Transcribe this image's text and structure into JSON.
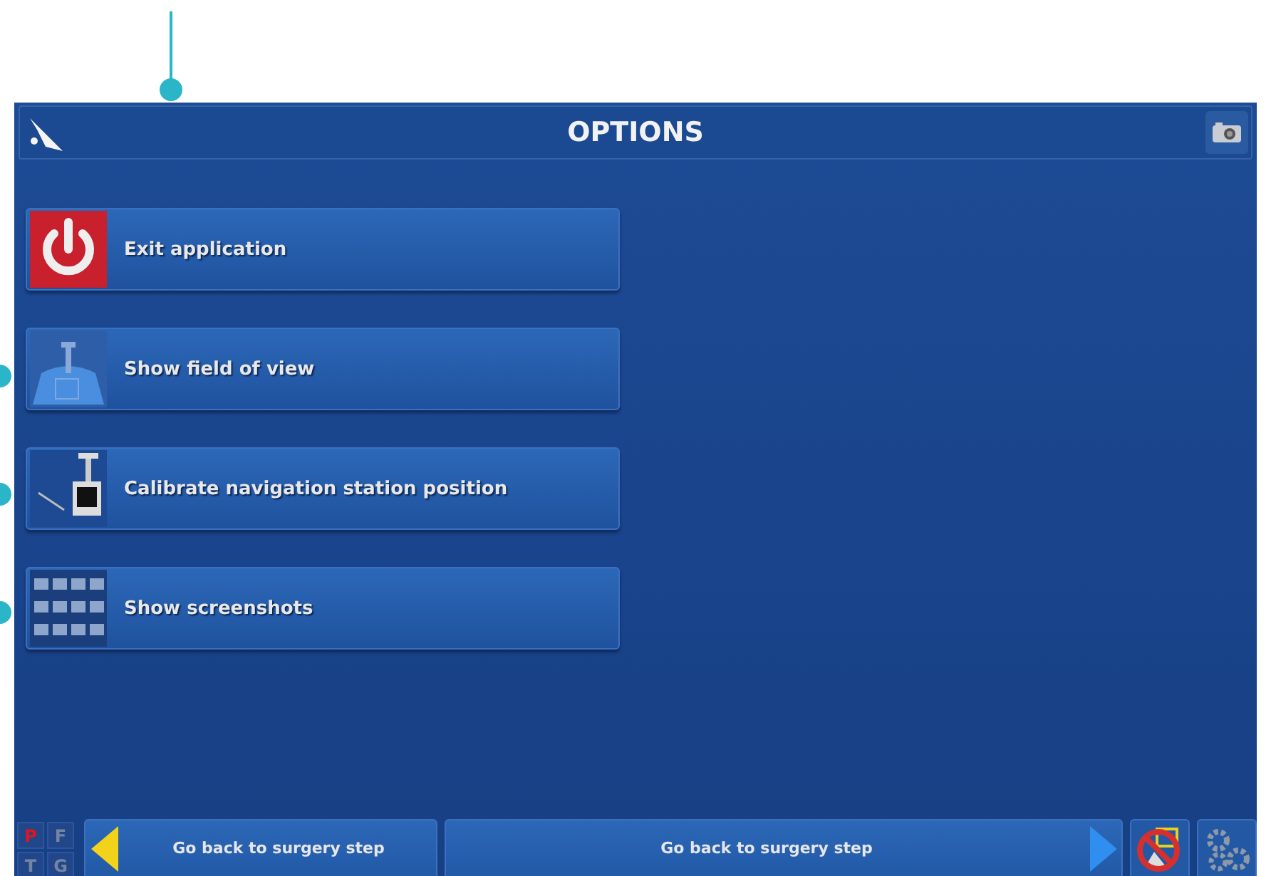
{
  "header": {
    "title": "OPTIONS"
  },
  "menu_items": [
    {
      "kind": "power",
      "label": "Exit application"
    },
    {
      "kind": "field",
      "label": "Show field of view"
    },
    {
      "kind": "station",
      "label": "Calibrate navigation station position"
    },
    {
      "kind": "screenshots",
      "label": "Show screenshots"
    }
  ],
  "mode_letters": [
    {
      "letter": "P",
      "active": true
    },
    {
      "letter": "F",
      "active": false
    },
    {
      "letter": "T",
      "active": false
    },
    {
      "letter": "G",
      "active": false
    }
  ],
  "bottom_bar": {
    "back_button": "Go back to surgery step",
    "next_button": "Go back to surgery step"
  }
}
